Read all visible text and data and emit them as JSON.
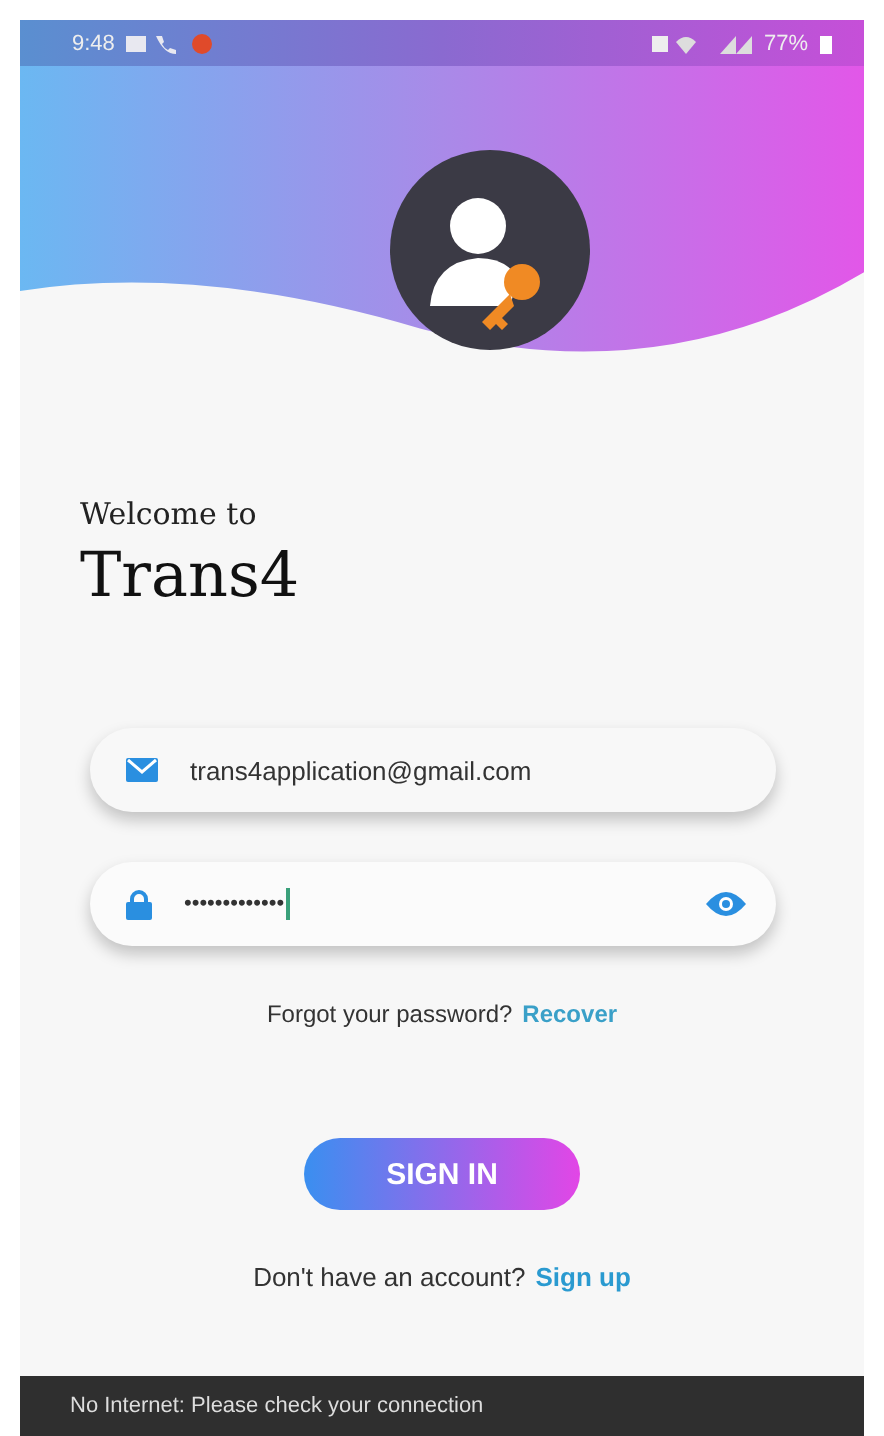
{
  "status_bar": {
    "time": "9:48",
    "battery": "77%"
  },
  "welcome": {
    "subtitle": "Welcome to",
    "title": "Trans4"
  },
  "email_field": {
    "value": "trans4application@gmail.com"
  },
  "password_field": {
    "value": "•••••••••••••",
    "focused": true
  },
  "forgot": {
    "text": "Forgot your password?",
    "link": "Recover"
  },
  "sign_in_button": {
    "label": "SIGN IN"
  },
  "signup": {
    "text": "Don't have an account?",
    "link": "Sign up"
  },
  "snackbar": {
    "message": "No Internet: Please check your connection"
  }
}
